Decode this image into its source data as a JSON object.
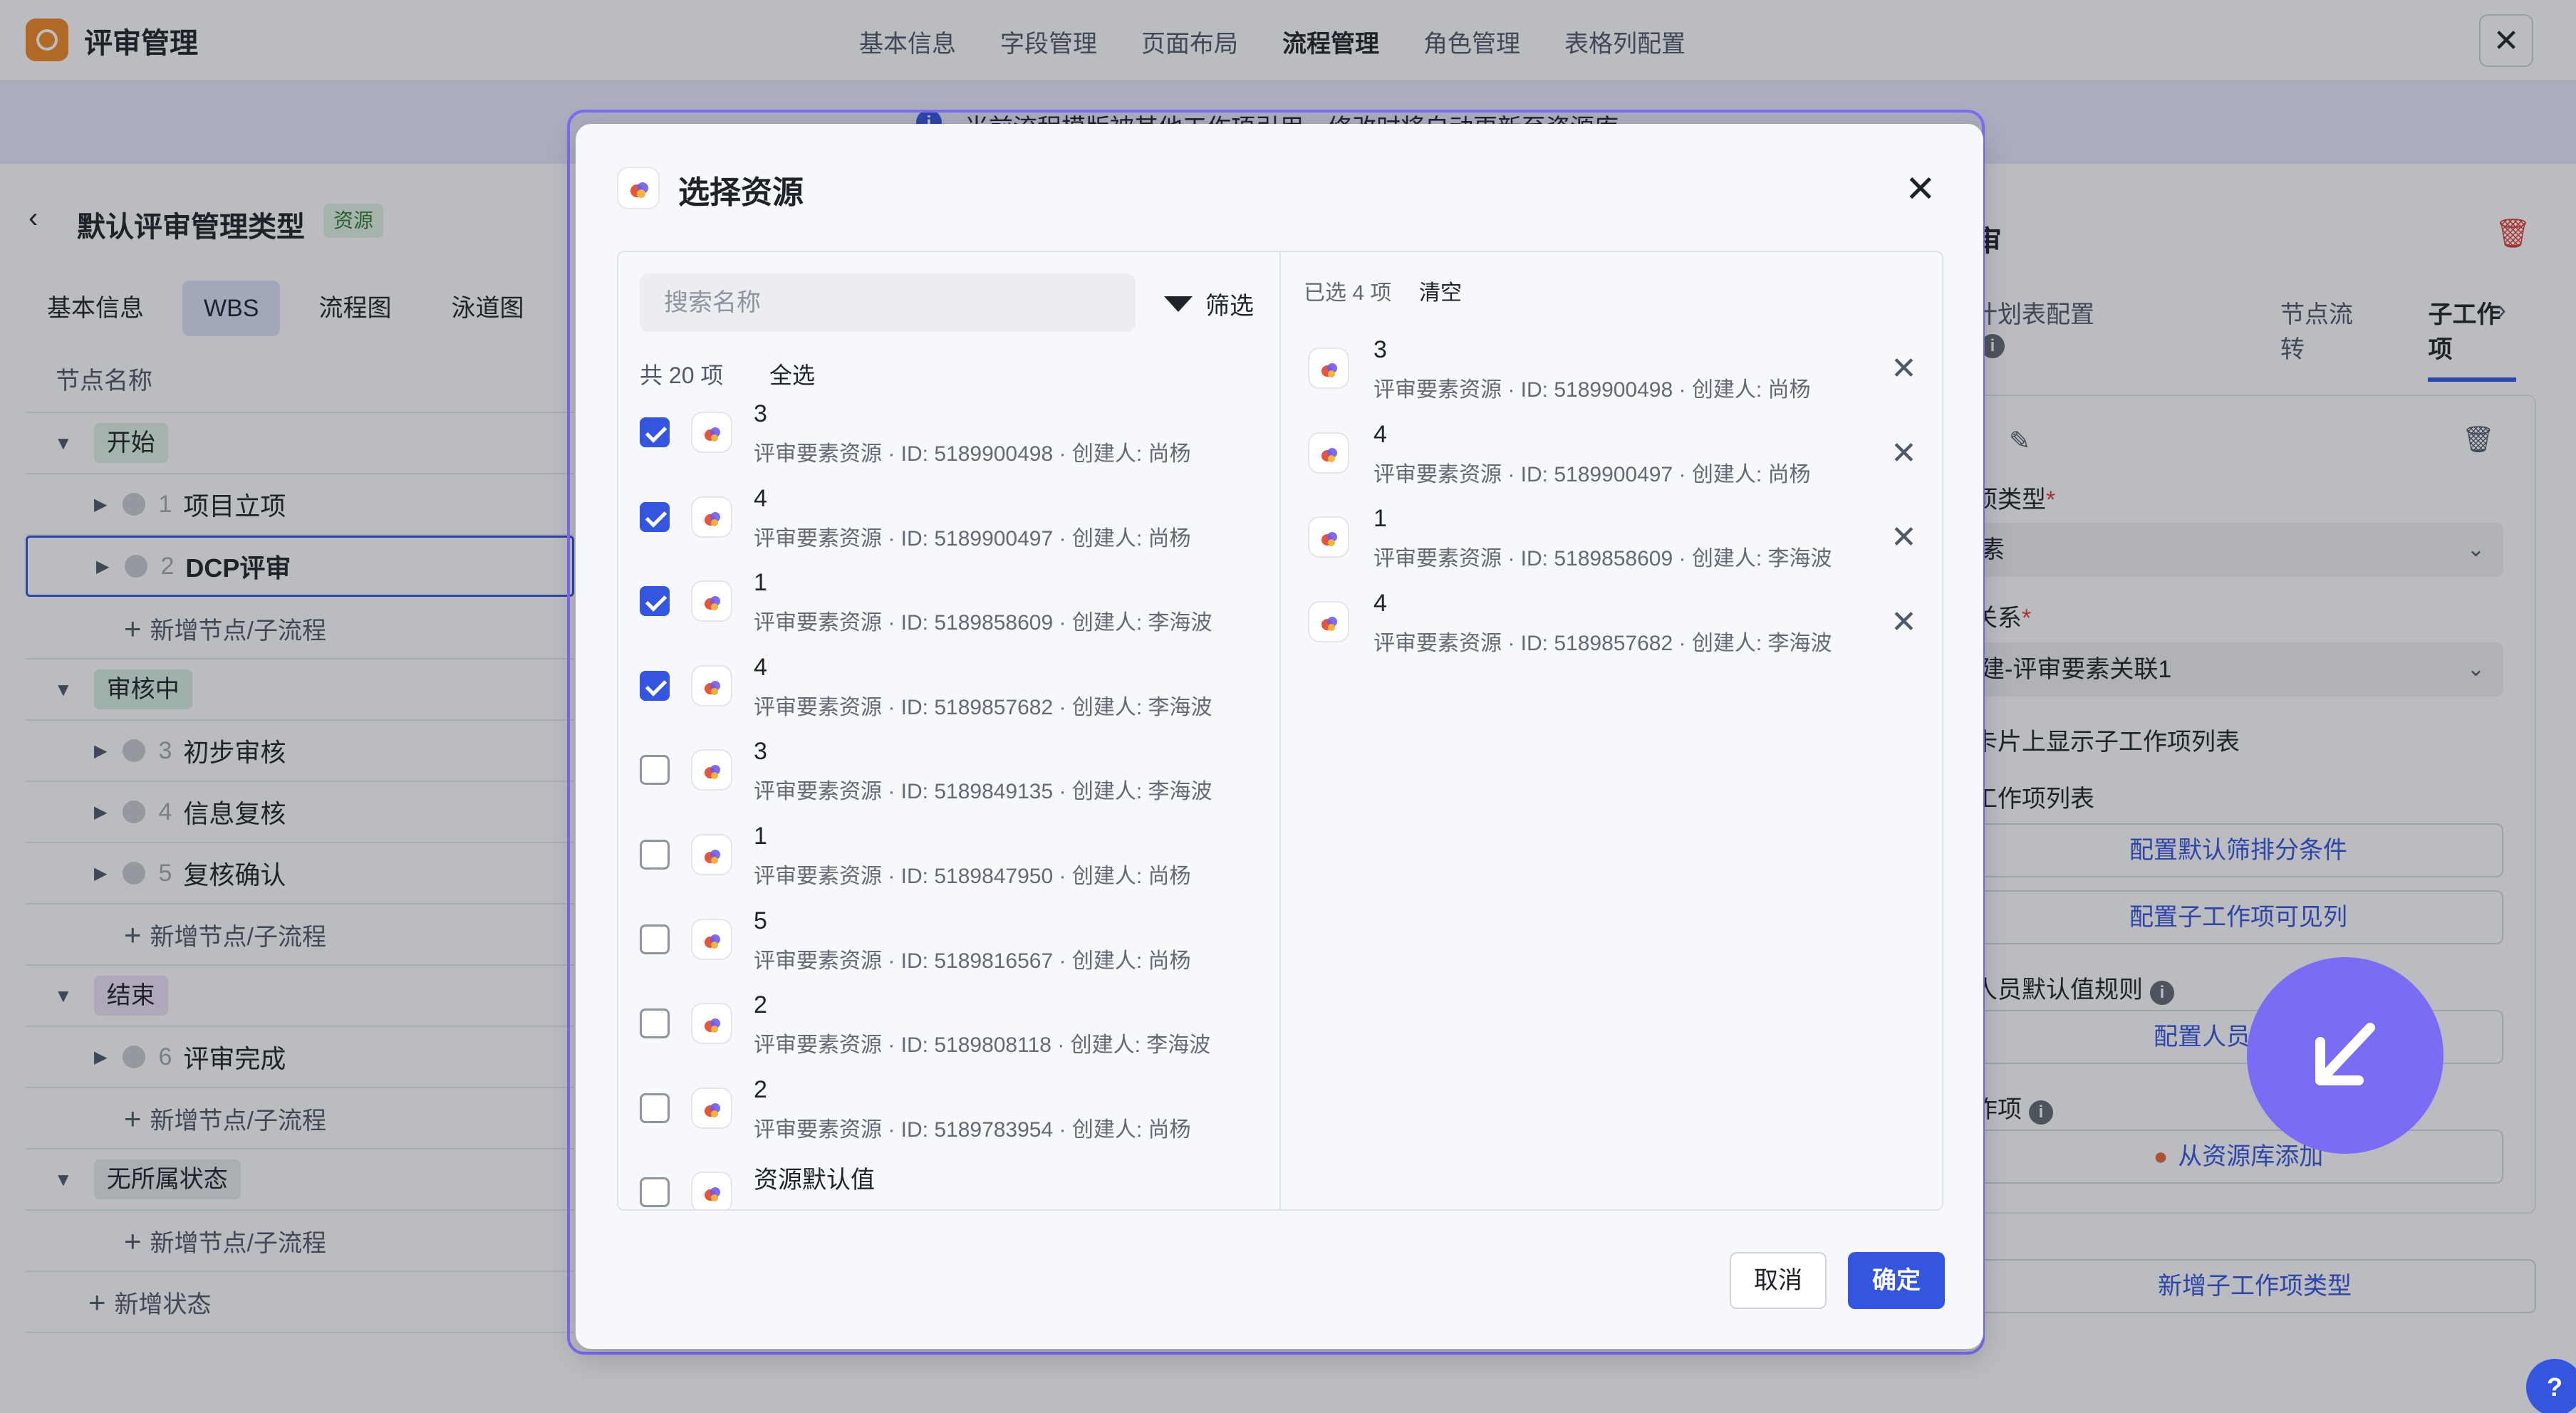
{
  "app": {
    "title": "评审管理"
  },
  "top_nav": [
    "基本信息",
    "字段管理",
    "页面布局",
    "流程管理",
    "角色管理",
    "表格列配置"
  ],
  "top_nav_active_index": 3,
  "banner": {
    "text": "当前流程模版被其他工作项引用，修改时将自动更新至资源库"
  },
  "type_header": {
    "title": "默认评审管理类型",
    "tag": "资源"
  },
  "left_tabs": [
    "基本信息",
    "WBS",
    "流程图",
    "泳道图"
  ],
  "left_tabs_active_index": 1,
  "tree": {
    "column_header": "节点名称",
    "add_node_label": "新增节点/子流程",
    "add_status_label": "新增状态",
    "groups": [
      {
        "status": "开始",
        "nodes": [
          {
            "num": "1",
            "name": "项目立项"
          },
          {
            "num": "2",
            "name": "DCP评审"
          }
        ]
      },
      {
        "status": "审核中",
        "nodes": [
          {
            "num": "3",
            "name": "初步审核"
          },
          {
            "num": "4",
            "name": "信息复核"
          },
          {
            "num": "5",
            "name": "复核确认"
          }
        ]
      },
      {
        "status": "结束",
        "nodes": [
          {
            "num": "6",
            "name": "评审完成"
          }
        ]
      },
      {
        "status": "无所属状态",
        "nodes": []
      }
    ]
  },
  "right_panel": {
    "title": "审",
    "tabs": [
      "计划表配置",
      "节点流转",
      "子工作项"
    ],
    "field_type_label": "项类型",
    "field_type_value": "素",
    "relation_label": "关系",
    "relation_value": "建-评审要素关联1",
    "show_on_card": "卡片上显示子工作项列表",
    "list_label": "工作项列表",
    "btn_filter": "配置默认筛排分条件",
    "btn_visible_cols": "配置子工作项可见列",
    "person_default_label": "人员默认值规则",
    "btn_person_default": "配置人员默认值",
    "workitem_label": "作项",
    "btn_from_library": "从资源库添加",
    "btn_add_subtype": "新增子工作项类型"
  },
  "modal": {
    "title": "选择资源",
    "search_placeholder": "搜索名称",
    "filter_label": "筛选",
    "total_label": "共 20 项",
    "select_all_label": "全选",
    "selected_label": "已选 4 项",
    "clear_label": "清空",
    "cancel_label": "取消",
    "confirm_label": "确定",
    "items": [
      {
        "name": "3",
        "meta": "评审要素资源 · ID: 5189900498 · 创建人: 尚杨",
        "checked": true
      },
      {
        "name": "4",
        "meta": "评审要素资源 · ID: 5189900497 · 创建人: 尚杨",
        "checked": true
      },
      {
        "name": "1",
        "meta": "评审要素资源 · ID: 5189858609 · 创建人: 李海波",
        "checked": true
      },
      {
        "name": "4",
        "meta": "评审要素资源 · ID: 5189857682 · 创建人: 李海波",
        "checked": true
      },
      {
        "name": "3",
        "meta": "评审要素资源 · ID: 5189849135 · 创建人: 李海波",
        "checked": false
      },
      {
        "name": "1",
        "meta": "评审要素资源 · ID: 5189847950 · 创建人: 尚杨",
        "checked": false
      },
      {
        "name": "5",
        "meta": "评审要素资源 · ID: 5189816567 · 创建人: 尚杨",
        "checked": false
      },
      {
        "name": "2",
        "meta": "评审要素资源 · ID: 5189808118 · 创建人: 李海波",
        "checked": false
      },
      {
        "name": "2",
        "meta": "评审要素资源 · ID: 5189783954 · 创建人: 尚杨",
        "checked": false
      },
      {
        "name": "资源默认值",
        "meta": "",
        "checked": false
      }
    ],
    "selected": [
      {
        "name": "3",
        "meta": "评审要素资源 · ID: 5189900498 · 创建人: 尚杨"
      },
      {
        "name": "4",
        "meta": "评审要素资源 · ID: 5189900497 · 创建人: 尚杨"
      },
      {
        "name": "1",
        "meta": "评审要素资源 · ID: 5189858609 · 创建人: 李海波"
      },
      {
        "name": "4",
        "meta": "评审要素资源 · ID: 5189857682 · 创建人: 李海波"
      }
    ]
  },
  "colors": {
    "accent": "#3455e0",
    "highlight": "#7b6cf6",
    "danger": "#e23c39",
    "brand": "#f08a24"
  }
}
